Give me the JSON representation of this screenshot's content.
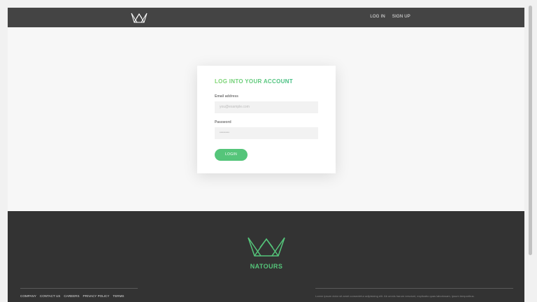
{
  "header": {
    "logo_icon": "crown-outline-icon",
    "nav": {
      "login": "LOG IN",
      "signup": "SIGN UP"
    }
  },
  "login": {
    "title": "LOG INTO YOUR ACCOUNT",
    "email_label": "Email address",
    "email_placeholder": "you@example.com",
    "email_value": "",
    "password_label": "Password",
    "password_placeholder": "••••••••",
    "password_value": "",
    "button_label": "LOGIN"
  },
  "footer": {
    "logo_icon": "crown-outline-icon",
    "brand": "NATOURS",
    "links": [
      "COMPANY",
      "CONTACT US",
      "CAREERS",
      "PRIVACY POLICY",
      "TERMS"
    ],
    "copyright": "Lorem ipsum dolor sit amet consectetur adipisicing elit. Ab omnis harum nesciunt, explicabo quas laboriosam, ipsum temporibus."
  },
  "colors": {
    "accent": "#55c57a",
    "header_bg": "#444444",
    "footer_bg": "#333333",
    "page_bg": "#f7f7f7"
  }
}
